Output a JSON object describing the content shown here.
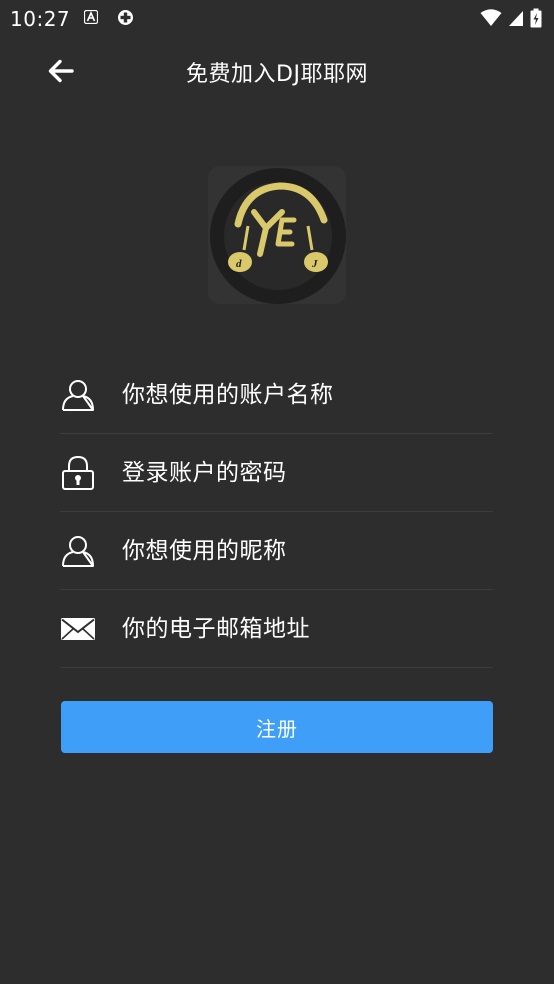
{
  "status_bar": {
    "time": "10:27"
  },
  "header": {
    "title": "免费加入DJ耶耶网"
  },
  "form": {
    "username_placeholder": "你想使用的账户名称",
    "password_placeholder": "登录账户的密码",
    "nickname_placeholder": "你想使用的昵称",
    "email_placeholder": "你的电子邮箱地址"
  },
  "actions": {
    "register_label": "注册"
  },
  "colors": {
    "background": "#2d2d2d",
    "button": "#3f9ff8",
    "logo_gold": "#d9c96a",
    "divider": "#3c3c3c"
  }
}
